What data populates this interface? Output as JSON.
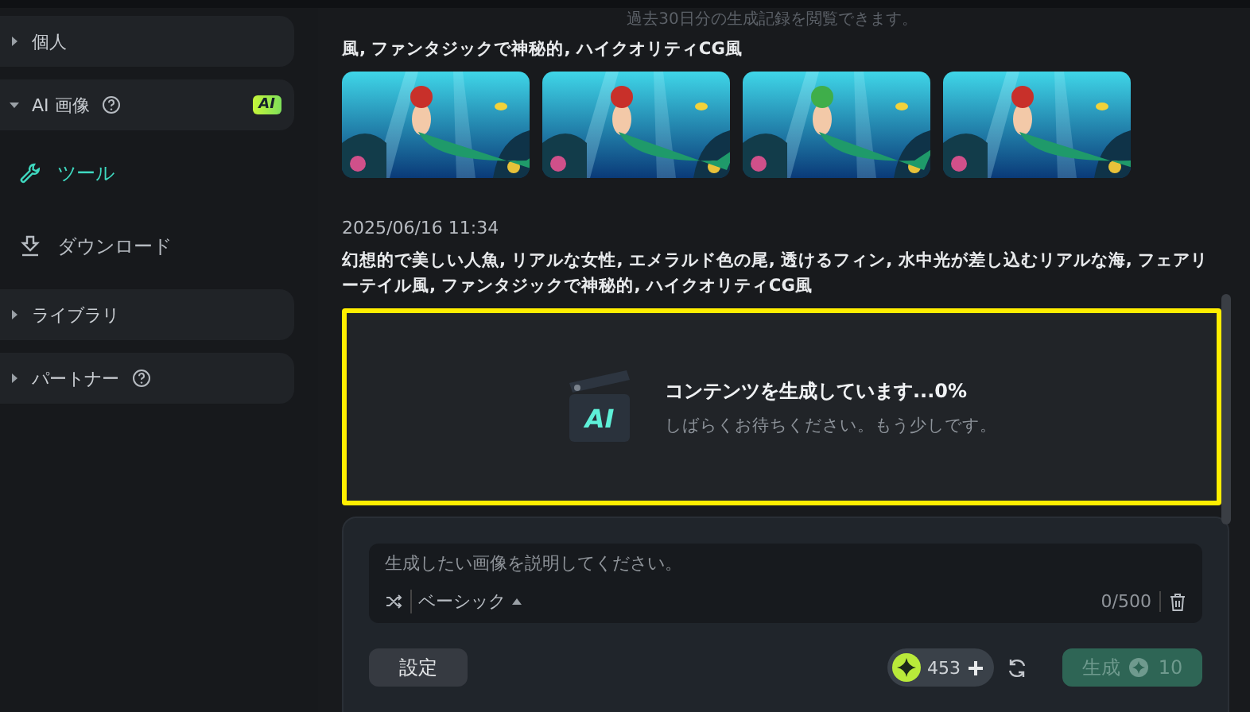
{
  "notice": "過去30日分の生成記録を閲覧できます。",
  "sidebar": {
    "items": [
      {
        "label": "個人",
        "expanded": false,
        "help": false
      },
      {
        "label": "AI 画像",
        "expanded": true,
        "help": true,
        "badge": "AI",
        "children": [
          {
            "label": "ツール",
            "selected": true
          },
          {
            "label": "ダウンロード",
            "selected": false
          }
        ]
      },
      {
        "label": "ライブラリ",
        "expanded": false,
        "help": false
      },
      {
        "label": "パートナー",
        "expanded": false,
        "help": true
      }
    ]
  },
  "history": [
    {
      "prompt": "風, ファンタジックで神秘的, ハイクオリティCG風"
    },
    {
      "date": "2025/06/16 11:34",
      "prompt": "幻想的で美しい人魚, リアルな女性, エメラルド色の尾, 透けるフィン, 水中光が差し込むリアルな海, フェアリーテイル風, ファンタジックで神秘的, ハイクオリティCG風",
      "generating": {
        "icon_text": "AI",
        "title": "コンテンツを生成しています...0%",
        "subtitle": "しばらくお待ちください。もう少しです。",
        "highlighted": true
      }
    }
  ],
  "composer": {
    "placeholder": "生成したい画像を説明してください。",
    "mode": "ベーシック",
    "counter": "0/500",
    "settings": "設定",
    "credits": "453",
    "generate": {
      "label": "生成",
      "cost": "10",
      "disabled": true
    }
  }
}
